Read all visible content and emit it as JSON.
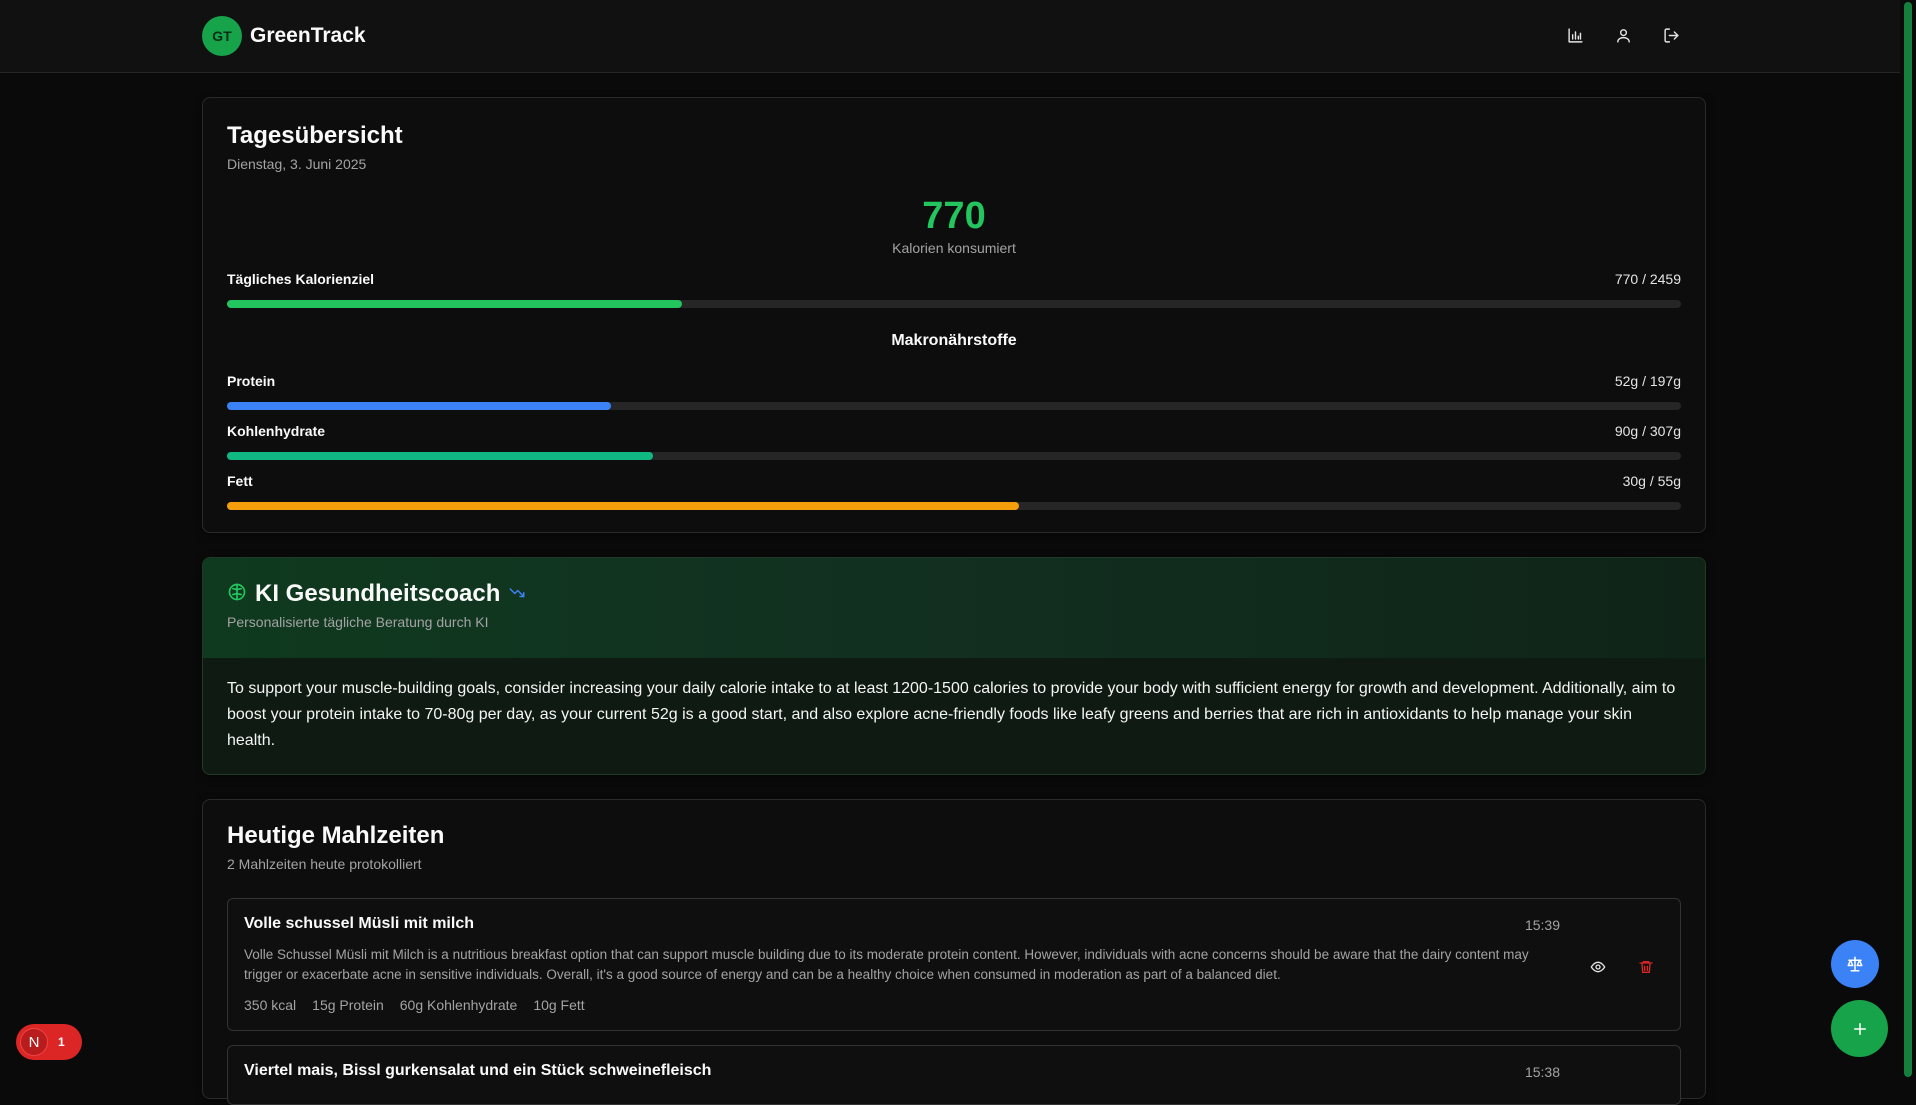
{
  "header": {
    "logo_text": "GT",
    "app_name": "GreenTrack",
    "icons": [
      "bar-chart-icon",
      "user-icon",
      "logout-icon"
    ]
  },
  "overview": {
    "title": "Tagesübersicht",
    "date": "Dienstag, 3. Juni 2025",
    "calories_value": "770",
    "calories_label": "Kalorien konsumiert",
    "goal_label": "Tägliches Kalorienziel",
    "goal_value": "770 / 2459",
    "goal_fraction": 0.313,
    "macros_title": "Makronährstoffe",
    "macros": [
      {
        "label": "Protein",
        "value": "52g / 197g",
        "fraction": 0.264,
        "color": "#3b82f6"
      },
      {
        "label": "Kohlenhydrate",
        "value": "90g / 307g",
        "fraction": 0.293,
        "color": "#10b981"
      },
      {
        "label": "Fett",
        "value": "30g / 55g",
        "fraction": 0.545,
        "color": "#f59e0b"
      }
    ],
    "accent_color": "#22c55e"
  },
  "coach": {
    "title": "KI Gesundheitscoach",
    "subtitle": "Personalisierte tägliche Beratung durch KI",
    "text": "To support your muscle-building goals, consider increasing your daily calorie intake to at least 1200-1500 calories to provide your body with sufficient energy for growth and development. Additionally, aim to boost your protein intake to 70-80g per day, as your current 52g is a good start, and also explore acne-friendly foods like leafy greens and berries that are rich in antioxidants to help manage your skin health."
  },
  "meals": {
    "title": "Heutige Mahlzeiten",
    "subtitle": "2 Mahlzeiten heute protokolliert",
    "items": [
      {
        "name": "Volle schussel Müsli mit milch",
        "time": "15:39",
        "description": "Volle Schussel Müsli mit Milch is a nutritious breakfast option that can support muscle building due to its moderate protein content. However, individuals with acne concerns should be aware that the dairy content may trigger or exacerbate acne in sensitive individuals. Overall, it's a good source of energy and can be a healthy choice when consumed in moderation as part of a balanced diet.",
        "kcal": "350 kcal",
        "protein": "15g Protein",
        "carbs": "60g Kohlenhydrate",
        "fat": "10g Fett"
      },
      {
        "name": "Viertel mais, Bissl gurkensalat und ein Stück schweinefleisch",
        "time": "15:38"
      }
    ]
  },
  "dev_badge": {
    "letter": "N",
    "count": "1"
  }
}
